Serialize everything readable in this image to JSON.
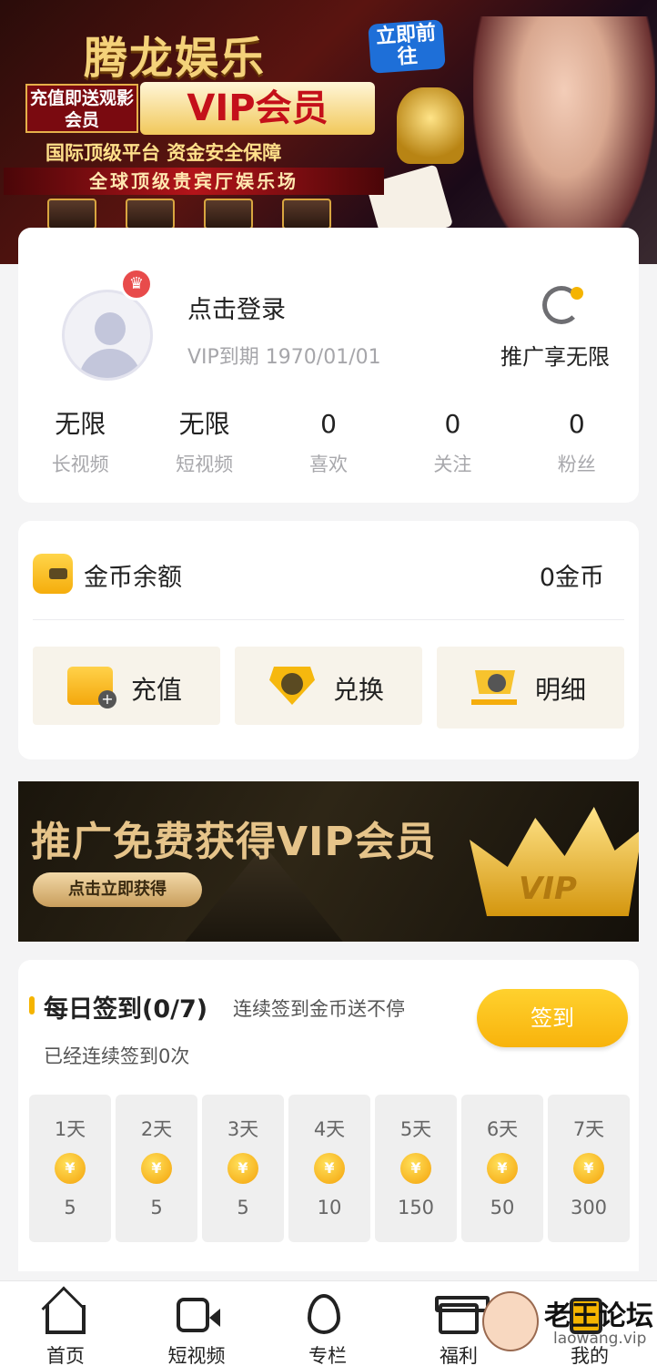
{
  "top_banner": {
    "title": "腾龙娱乐",
    "go_button": "立即前往",
    "promo_tag": "充值即送观影会员",
    "vip_text": "VIP会员",
    "subtitle": "国际顶级平台 资金安全保障",
    "hall": "全球顶级贵宾厅娱乐场"
  },
  "profile": {
    "login_text": "点击登录",
    "vip_expiry": "VIP到期 1970/01/01",
    "promo_label": "推广享无限",
    "stats": [
      {
        "value": "无限",
        "label": "长视频"
      },
      {
        "value": "无限",
        "label": "短视频"
      },
      {
        "value": "0",
        "label": "喜欢"
      },
      {
        "value": "0",
        "label": "关注"
      },
      {
        "value": "0",
        "label": "粉丝"
      }
    ]
  },
  "wallet": {
    "label": "金币余额",
    "balance": "0金币",
    "actions": [
      {
        "label": "充值",
        "icon": "wallet-add-icon"
      },
      {
        "label": "兑换",
        "icon": "exchange-icon"
      },
      {
        "label": "明细",
        "icon": "cart-check-icon"
      }
    ]
  },
  "vip_banner": {
    "title": "推广免费获得VIP会员",
    "button": "点击立即获得",
    "crown_text": "VIP"
  },
  "checkin": {
    "title": "每日签到(0/7)",
    "subtitle": "连续签到金币送不停",
    "streak": "已经连续签到0次",
    "button": "签到",
    "coin_symbol": "¥",
    "days": [
      {
        "label": "1天",
        "reward": "5"
      },
      {
        "label": "2天",
        "reward": "5"
      },
      {
        "label": "3天",
        "reward": "5"
      },
      {
        "label": "4天",
        "reward": "10"
      },
      {
        "label": "5天",
        "reward": "150"
      },
      {
        "label": "6天",
        "reward": "50"
      },
      {
        "label": "7天",
        "reward": "300"
      }
    ]
  },
  "bottom_nav": [
    {
      "label": "首页",
      "icon": "home-icon"
    },
    {
      "label": "短视频",
      "icon": "video-icon"
    },
    {
      "label": "专栏",
      "icon": "fire-icon"
    },
    {
      "label": "福利",
      "icon": "gift-icon"
    },
    {
      "label": "我的",
      "icon": "user-icon"
    }
  ],
  "watermark": {
    "title": "老王论坛",
    "url": "laowang.vip"
  },
  "colors": {
    "accent": "#f5b400",
    "page_bg": "#f4f4f5",
    "card_bg": "#ffffff",
    "muted_text": "#a8a8ac"
  }
}
